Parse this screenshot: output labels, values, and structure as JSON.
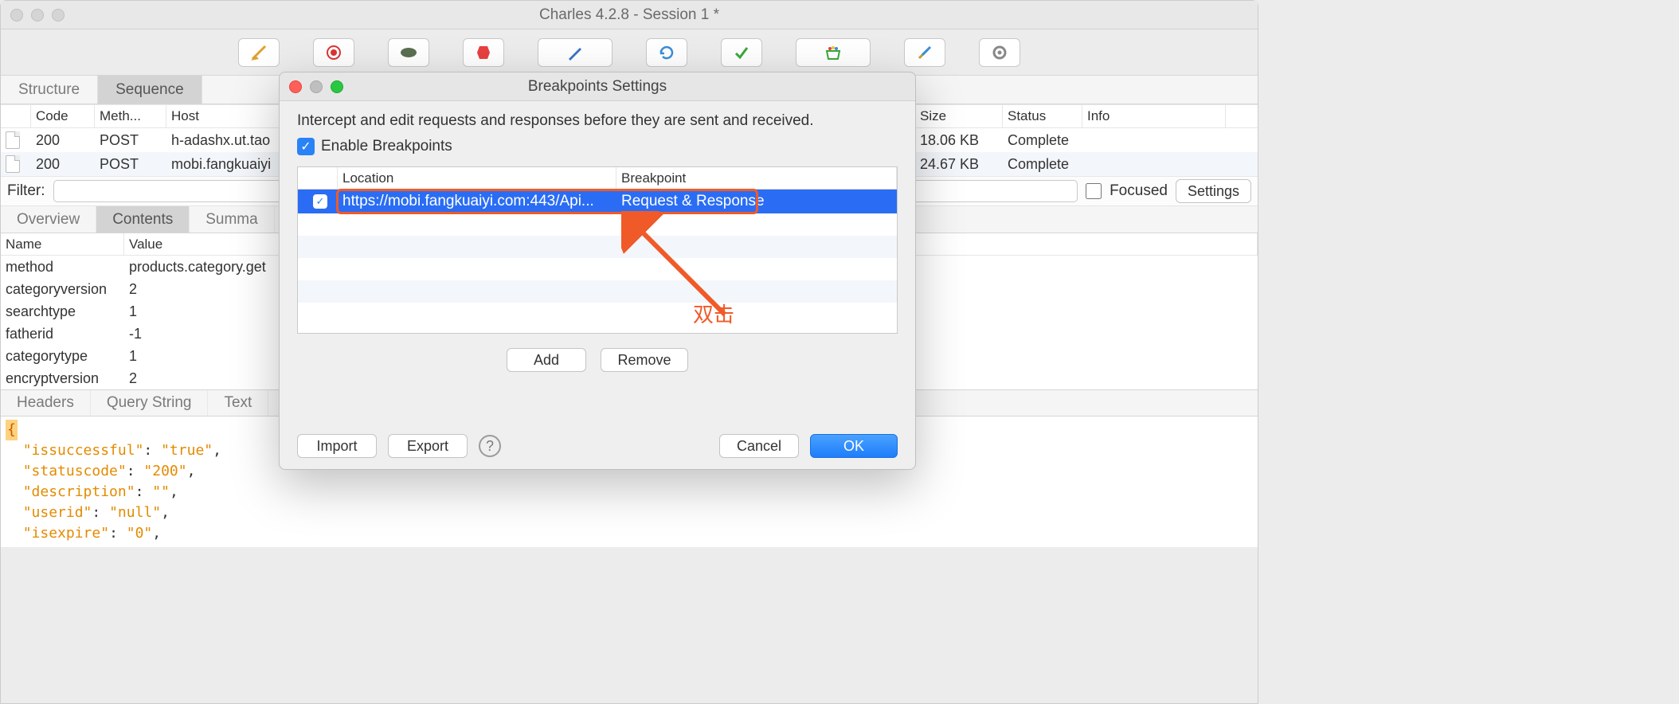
{
  "window": {
    "title": "Charles 4.2.8 - Session 1 *"
  },
  "tabs": {
    "structure": "Structure",
    "sequence": "Sequence"
  },
  "list": {
    "headers": [
      "",
      "Code",
      "Meth...",
      "Host",
      "Size",
      "Status",
      "Info"
    ],
    "rows": [
      {
        "code": "200",
        "method": "POST",
        "host": "h-adashx.ut.tao",
        "size": "18.06 KB",
        "status": "Complete",
        "info": ""
      },
      {
        "code": "200",
        "method": "POST",
        "host": "mobi.fangkuaiyi",
        "size": "24.67 KB",
        "status": "Complete",
        "info": ""
      }
    ]
  },
  "filter": {
    "label": "Filter:",
    "value": "",
    "focused_label": "Focused",
    "settings_label": "Settings"
  },
  "inner_tabs": {
    "overview": "Overview",
    "contents": "Contents",
    "summa": "Summa"
  },
  "kv": {
    "name_header": "Name",
    "value_header": "Value",
    "rows": [
      {
        "name": "method",
        "value": "products.category.get"
      },
      {
        "name": "categoryversion",
        "value": "2"
      },
      {
        "name": "searchtype",
        "value": "1"
      },
      {
        "name": "fatherid",
        "value": "-1"
      },
      {
        "name": "categorytype",
        "value": "1"
      },
      {
        "name": "encryptversion",
        "value": "2"
      }
    ]
  },
  "bottom_tabs": {
    "headers": "Headers",
    "query_string": "Query String",
    "text": "Text"
  },
  "json": {
    "line1_key": "\"issuccessful\"",
    "line1_val": "\"true\"",
    "line2_key": "\"statuscode\"",
    "line2_val": "\"200\"",
    "line3_key": "\"description\"",
    "line3_val": "\"\"",
    "line4_key": "\"userid\"",
    "line4_val": "\"null\"",
    "line5_key": "\"isexpire\"",
    "line5_val": "\"0\""
  },
  "dialog": {
    "title": "Breakpoints Settings",
    "intercept_text": "Intercept and edit requests and responses before they are sent and received.",
    "enable_label": "Enable Breakpoints",
    "col_location": "Location",
    "col_breakpoint": "Breakpoint",
    "row_location": "https://mobi.fangkuaiyi.com:443/Api...",
    "row_breakpoint": "Request & Response",
    "add": "Add",
    "remove": "Remove",
    "import": "Import",
    "export": "Export",
    "cancel": "Cancel",
    "ok": "OK"
  },
  "annotation": {
    "label": "双击"
  }
}
